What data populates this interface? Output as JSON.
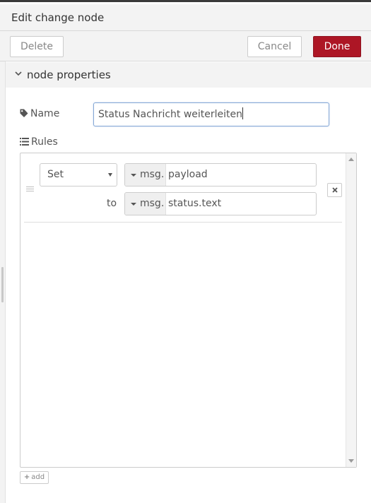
{
  "header": {
    "title": "Edit change node"
  },
  "toolbar": {
    "delete_label": "Delete",
    "cancel_label": "Cancel",
    "done_label": "Done"
  },
  "section": {
    "title": "node properties",
    "icon": "chevron-down-icon"
  },
  "form": {
    "name_label": "Name",
    "name_icon": "tag-icon",
    "name_value": "Status Nachricht weiterleiten",
    "rules_label": "Rules",
    "rules_icon": "list-icon"
  },
  "rules": [
    {
      "action": "Set",
      "target_type": "msg.",
      "target_value": "payload",
      "to_label": "to",
      "source_type": "msg.",
      "source_value": "status.text",
      "remove_icon": "close-icon"
    }
  ],
  "add_button": {
    "label": "add",
    "icon": "plus-icon"
  },
  "colors": {
    "done_button": "#ad1625",
    "focused_input_border": "#85a8d6"
  }
}
